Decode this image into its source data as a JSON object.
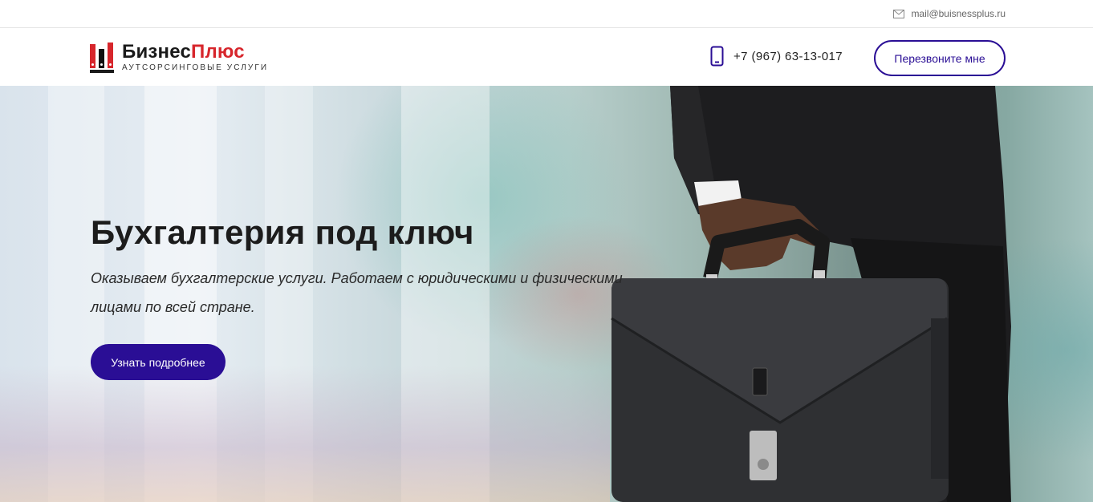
{
  "topbar": {
    "email": "mail@buisnessplus.ru",
    "email_icon": "envelope-icon"
  },
  "header": {
    "logo": {
      "name_part1": "Бизнес",
      "name_part2": "Плюс",
      "tagline": "АУТСОРСИНГОВЫЕ УСЛУГИ"
    },
    "phone_icon": "mobile-phone-icon",
    "phone": "+7 (967) 63-13-017",
    "callback_label": "Перезвоните мне"
  },
  "hero": {
    "title": "Бухгалтерия под ключ",
    "subtitle": "Оказываем бухгалтерские услуги. Работаем с юридическими и физическими лицами по всей стране.",
    "button_label": "Узнать подробнее"
  },
  "colors": {
    "accent": "#2a0e95",
    "brand_red": "#d7262c"
  }
}
